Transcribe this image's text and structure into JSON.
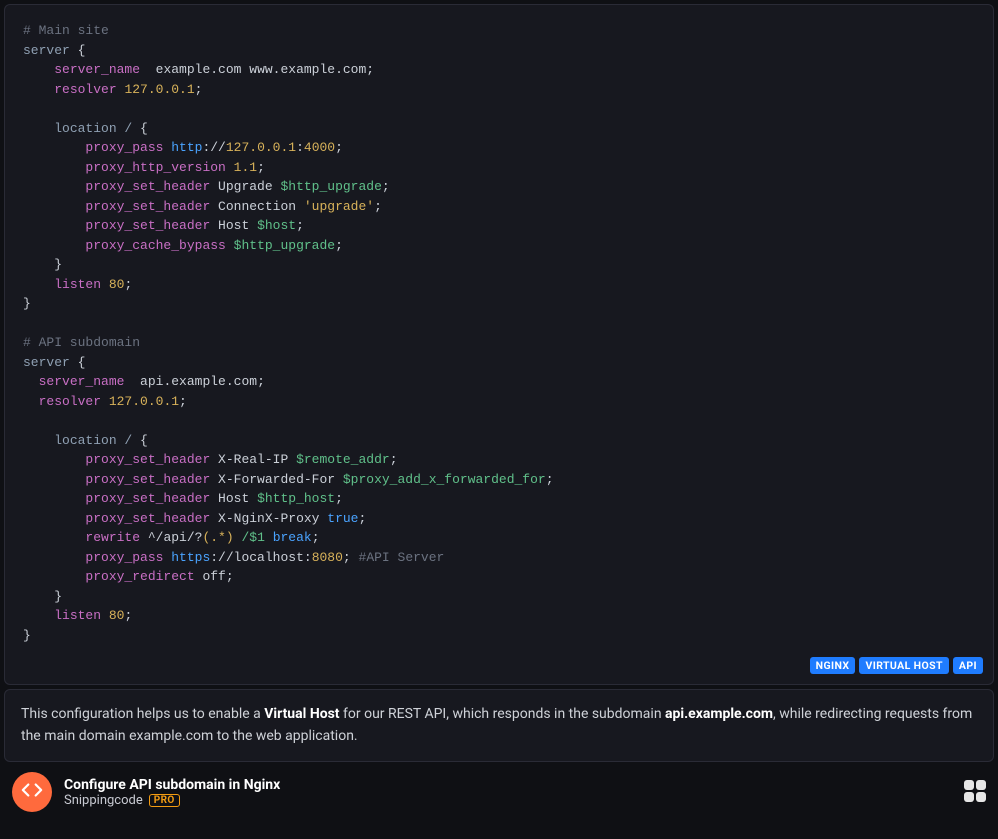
{
  "code": {
    "l1": "# Main site",
    "l2_server": "server",
    "brace_open": " {",
    "l3_dir": "server_name",
    "l3_val": "  example.com www.example.com",
    "semi": ";",
    "l4_dir": "resolver",
    "l4_num": " 127.0.0.1",
    "l6_loc": "location / ",
    "l7_dir": "proxy_pass",
    "l7_http": " http",
    "l7_sep": "://",
    "l7_ip": "127.0.0.1",
    "l7_colon": ":",
    "l7_port": "4000",
    "l8_dir": "proxy_http_version",
    "l8_num": " 1.1",
    "l9_dir": "proxy_set_header",
    "l9_arg1": " Upgrade ",
    "l9_var": "$http_upgrade",
    "l10_arg1": " Connection ",
    "l10_str": "'upgrade'",
    "l11_arg1": " Host ",
    "l11_var": "$host",
    "l12_dir": "proxy_cache_bypass",
    "l12_sp": " ",
    "l12_var": "$http_upgrade",
    "brace_close": "}",
    "l14_dir": "listen",
    "l14_num": " 80",
    "api_c": "# API subdomain",
    "api_sn_val": "  api.example.com",
    "res_num": " 127.0.0.1",
    "xrip": " X-Real-IP ",
    "var_ra": "$remote_addr",
    "xff": " X-Forwarded-For ",
    "var_xff": "$proxy_add_x_forwarded_for",
    "host2": " Host ",
    "var_hh": "$http_host",
    "xnp": " X-NginX-Proxy ",
    "true_kw": "true",
    "rewrite": "rewrite",
    "rewrite_arg1": " ^",
    "rewrite_path": "/api/?",
    "rewrite_grp": "(.*)",
    "rewrite_rep_sp": " ",
    "rewrite_rep": "/$1",
    "rewrite_break": " break",
    "pp_https": " https",
    "pp_host": "localhost",
    "pp_port2": "8080",
    "pp_cmt": " #API Server",
    "pr_dir": "proxy_redirect",
    "pr_off": " off"
  },
  "tags": [
    "NGINX",
    "VIRTUAL HOST",
    "API"
  ],
  "desc": {
    "p1a": "This configuration helps us to enable a ",
    "p1b": "Virtual Host",
    "p1c": " for our REST API, which responds in the subdomain ",
    "p1d": "api.example.com",
    "p1e": ", while redirecting requests from the main domain example.com to the web application."
  },
  "footer": {
    "title": "Configure API subdomain in Nginx",
    "author": "Snippingcode",
    "pro": "PRO"
  }
}
